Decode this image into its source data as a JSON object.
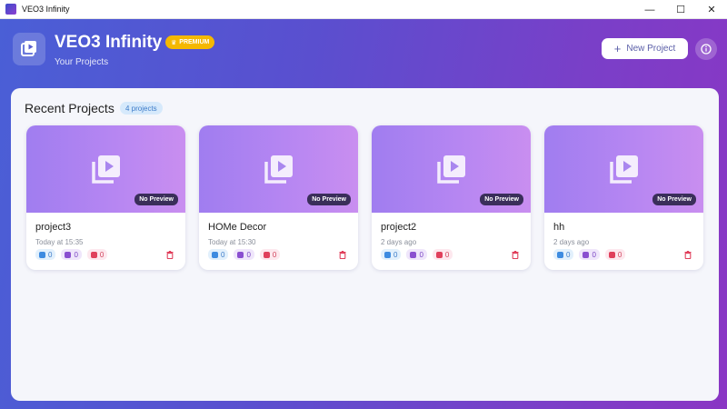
{
  "window": {
    "title": "VEO3 Infinity",
    "controls": [
      "—",
      "☐",
      "✕"
    ]
  },
  "header": {
    "app_name": "VEO3 Infinity",
    "badge": "PREMIUM",
    "subtitle": "Your Projects",
    "new_project_label": "New Project"
  },
  "recent": {
    "title": "Recent Projects",
    "count_label": "4 projects",
    "no_preview_label": "No Preview",
    "projects": [
      {
        "name": "project3",
        "time": "Today at 15:35",
        "docs": "0",
        "videos": "0",
        "images": "0"
      },
      {
        "name": "HOMe Decor",
        "time": "Today at 15:30",
        "docs": "0",
        "videos": "0",
        "images": "0"
      },
      {
        "name": "project2",
        "time": "2 days ago",
        "docs": "0",
        "videos": "0",
        "images": "0"
      },
      {
        "name": "hh",
        "time": "2 days ago",
        "docs": "0",
        "videos": "0",
        "images": "0"
      }
    ]
  },
  "colors": {
    "accent": "#5b4fcf",
    "premium": "#f5b800",
    "thumb": "#b887f2"
  },
  "icons": [
    "app-icon",
    "logo-video-icon",
    "crown-icon",
    "plus-icon",
    "info-icon",
    "video-library-icon",
    "document-icon",
    "video-icon",
    "image-icon",
    "trash-icon"
  ]
}
